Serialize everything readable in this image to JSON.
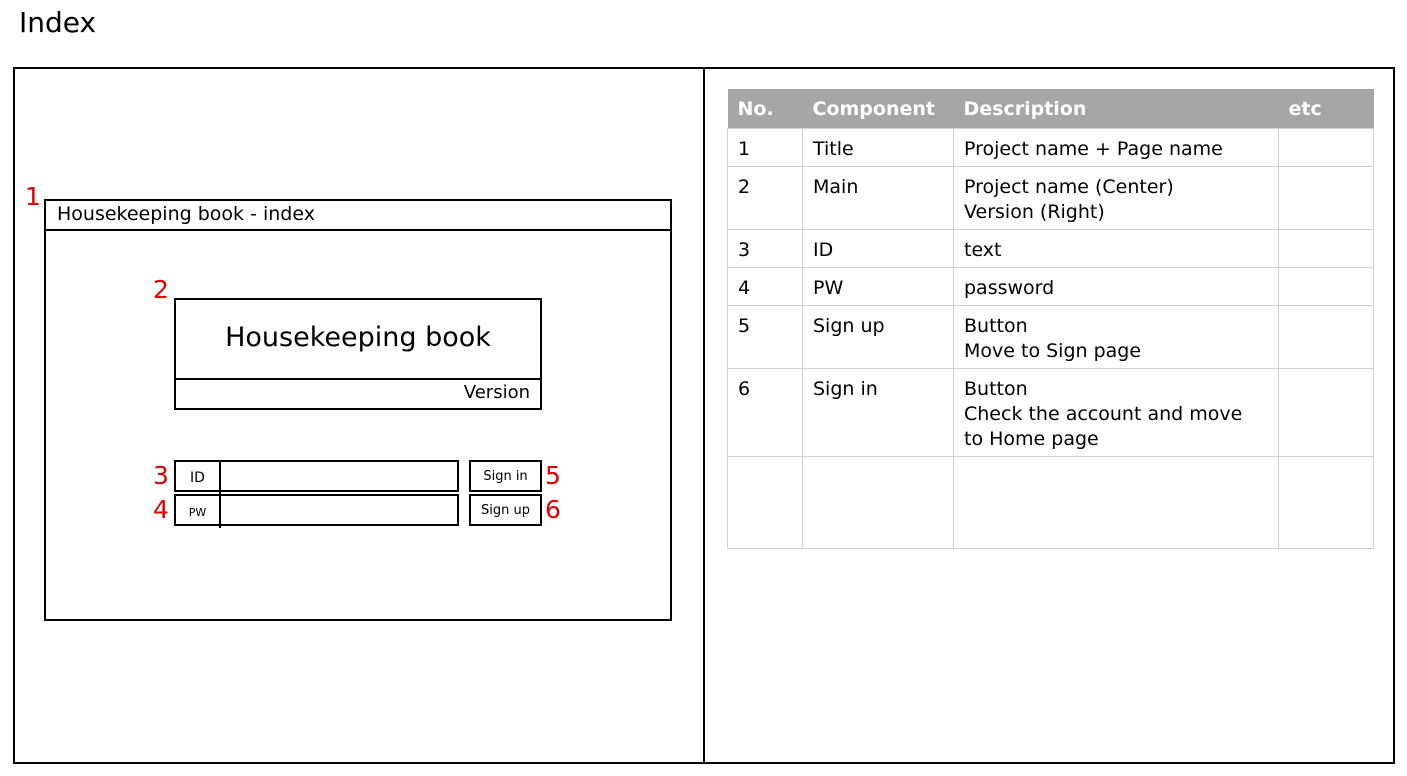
{
  "page_title": "Index",
  "mock": {
    "window_title": "Housekeeping book - index",
    "main_title": "Housekeeping book",
    "version": "Version",
    "id_label": "ID",
    "pw_label": "PW",
    "signin_label": "Sign in",
    "signup_label": "Sign up",
    "markers": [
      "1",
      "2",
      "3",
      "4",
      "5",
      "6"
    ]
  },
  "table": {
    "headers": [
      "No.",
      "Component",
      "Description",
      "etc"
    ],
    "rows": [
      {
        "no": "1",
        "component": "Title",
        "desc": [
          "Project name + Page name"
        ],
        "etc": ""
      },
      {
        "no": "2",
        "component": "Main",
        "desc": [
          "Project name (Center)",
          "Version (Right)"
        ],
        "etc": ""
      },
      {
        "no": "3",
        "component": "ID",
        "desc": [
          "text"
        ],
        "etc": ""
      },
      {
        "no": "4",
        "component": "PW",
        "desc": [
          "password"
        ],
        "etc": ""
      },
      {
        "no": "5",
        "component": "Sign up",
        "desc": [
          "Button",
          "Move to Sign page"
        ],
        "etc": ""
      },
      {
        "no": "6",
        "component": "Sign in",
        "desc": [
          "Button",
          "Check the account and move",
          "to Home page"
        ],
        "etc": ""
      }
    ]
  },
  "colors": {
    "marker": "#e00000",
    "table_header": "#a6a6a6"
  }
}
